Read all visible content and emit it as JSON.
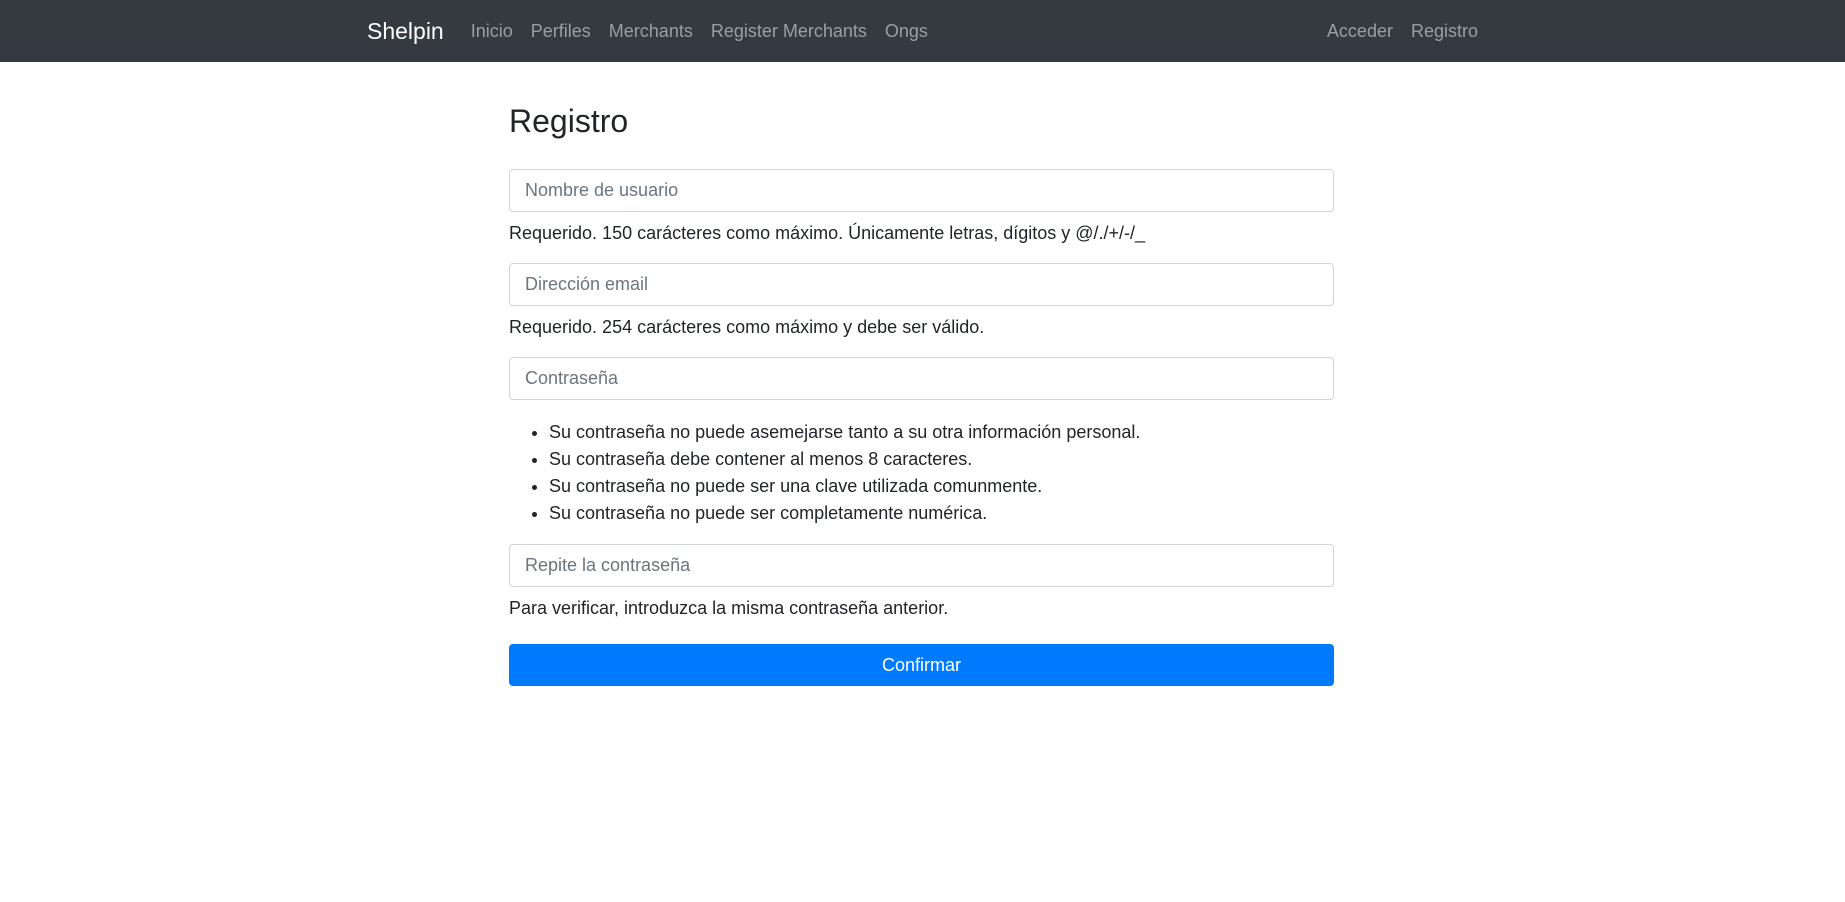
{
  "navbar": {
    "brand": "Shelpin",
    "left_links": [
      "Inicio",
      "Perfiles",
      "Merchants",
      "Register Merchants",
      "Ongs"
    ],
    "right_links": [
      "Acceder",
      "Registro"
    ]
  },
  "page": {
    "title": "Registro"
  },
  "form": {
    "username": {
      "placeholder": "Nombre de usuario",
      "value": "",
      "help": "Requerido. 150 carácteres como máximo. Únicamente letras, dígitos y @/./+/-/_"
    },
    "email": {
      "placeholder": "Dirección email",
      "value": "",
      "help": "Requerido. 254 carácteres como máximo y debe ser válido."
    },
    "password": {
      "placeholder": "Contraseña",
      "value": "",
      "rules": [
        "Su contraseña no puede asemejarse tanto a su otra información personal.",
        "Su contraseña debe contener al menos 8 caracteres.",
        "Su contraseña no puede ser una clave utilizada comunmente.",
        "Su contraseña no puede ser completamente numérica."
      ]
    },
    "password_confirm": {
      "placeholder": "Repite la contraseña",
      "value": "",
      "help": "Para verificar, introduzca la misma contraseña anterior."
    },
    "submit_label": "Confirmar"
  },
  "colors": {
    "navbar_bg": "#343a40",
    "primary": "#007bff"
  }
}
